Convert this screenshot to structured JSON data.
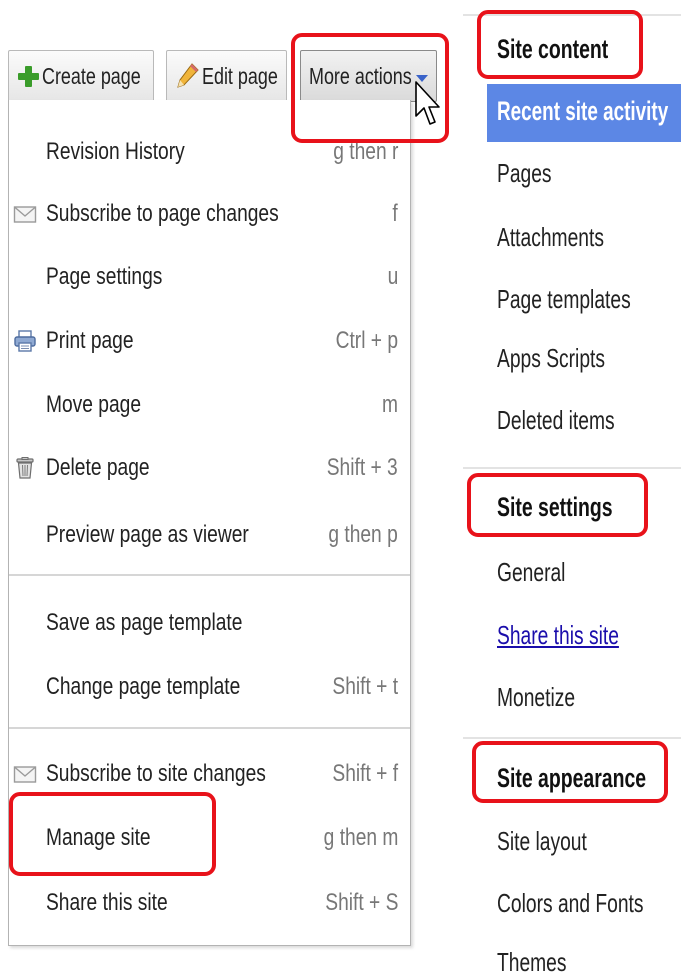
{
  "toolbar": {
    "create_label": "Create page",
    "edit_label": "Edit page",
    "more_label": "More actions"
  },
  "menu": {
    "items": [
      {
        "label": "Revision History",
        "shortcut": "g then r"
      },
      {
        "label": "Subscribe to page changes",
        "shortcut": "f",
        "icon": "envelope-icon"
      },
      {
        "label": "Page settings",
        "shortcut": "u"
      },
      {
        "label": "Print page",
        "shortcut": "Ctrl + p",
        "icon": "printer-icon"
      },
      {
        "label": "Move page",
        "shortcut": "m"
      },
      {
        "label": "Delete page",
        "shortcut": "Shift + 3",
        "icon": "trash-icon"
      },
      {
        "label": "Preview page as viewer",
        "shortcut": "g then p"
      },
      {
        "label": "Save as page template",
        "shortcut": ""
      },
      {
        "label": "Change page template",
        "shortcut": "Shift + t"
      },
      {
        "label": "Subscribe to site changes",
        "shortcut": "Shift + f",
        "icon": "envelope-icon"
      },
      {
        "label": "Manage site",
        "shortcut": "g then m"
      },
      {
        "label": "Share this site",
        "shortcut": "Shift + S"
      }
    ]
  },
  "panel": {
    "content_heading": "Site content",
    "content_items": [
      "Recent site activity",
      "Pages",
      "Attachments",
      "Page templates",
      "Apps Scripts",
      "Deleted items"
    ],
    "settings_heading": "Site settings",
    "settings_items": [
      "General",
      "Share this site",
      "Monetize"
    ],
    "appearance_heading": "Site appearance",
    "appearance_items": [
      "Site layout",
      "Colors and Fonts",
      "Themes"
    ]
  },
  "colors": {
    "highlight": "#e8121a",
    "active_item_bg": "#5c87e5",
    "link": "#1a0dab"
  }
}
